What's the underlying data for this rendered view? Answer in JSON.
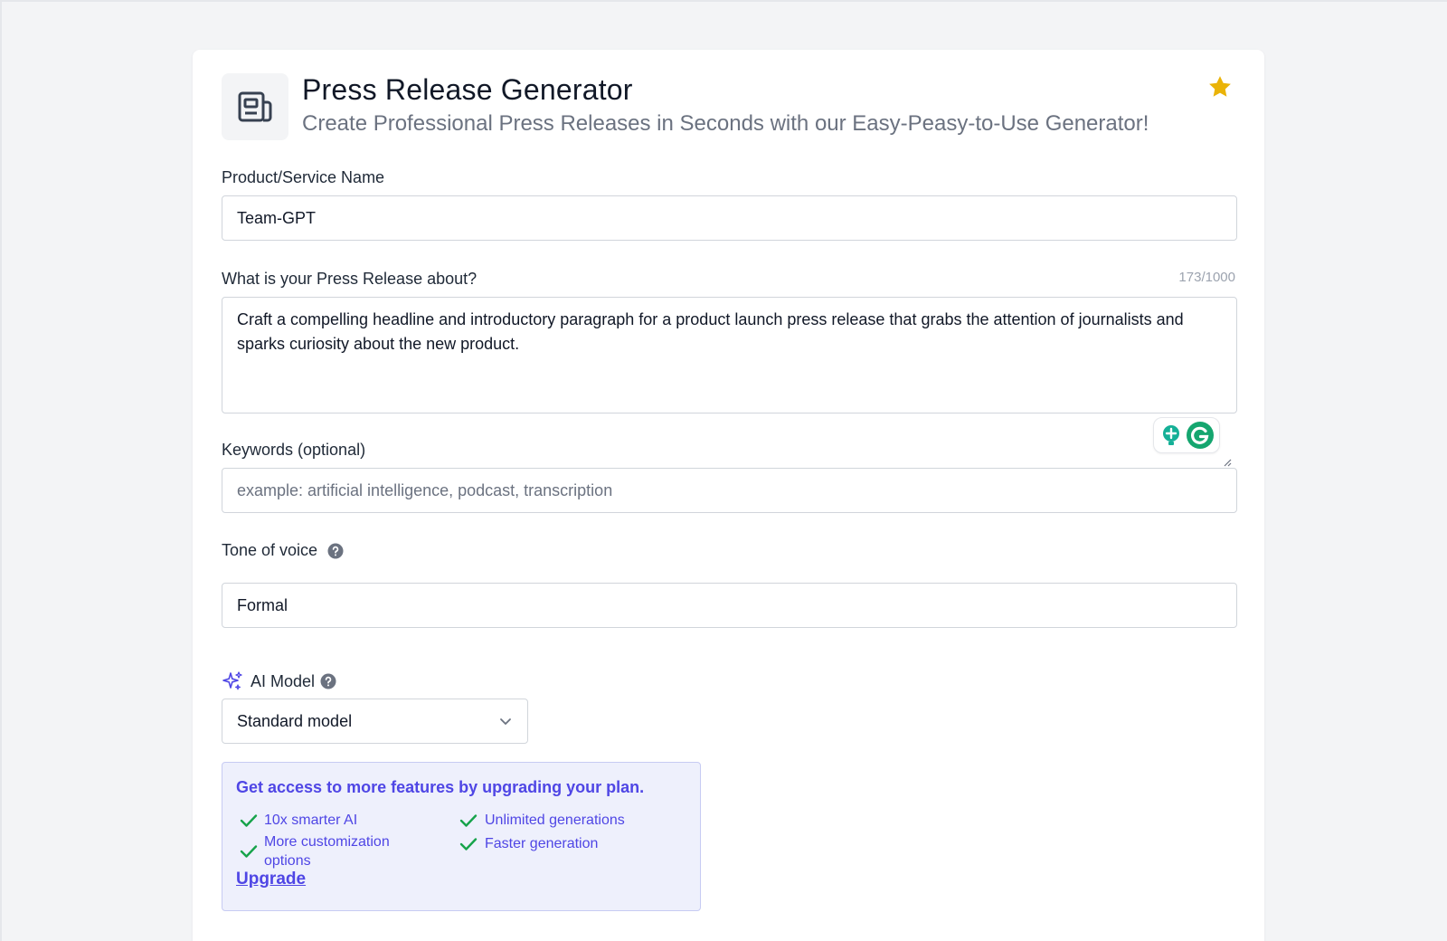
{
  "header": {
    "title": "Press Release Generator",
    "subtitle": "Create Professional Press Releases in Seconds with our Easy-Peasy-to-Use Generator!",
    "icon": "newspaper-icon",
    "favorite_icon": "star-icon",
    "favorite_color": "#eab308"
  },
  "product_name": {
    "label": "Product/Service Name",
    "value": "Team-GPT"
  },
  "about": {
    "label": "What is your Press Release about?",
    "counter": "173/1000",
    "value": "Craft a compelling headline and introductory paragraph for a product launch press release that grabs the attention of journalists and sparks curiosity about the new product."
  },
  "keywords": {
    "label": "Keywords (optional)",
    "placeholder": "example: artificial intelligence, podcast, transcription"
  },
  "tone": {
    "label": "Tone of voice",
    "value": "Formal"
  },
  "ai_model": {
    "label": "AI Model",
    "selected": "Standard model"
  },
  "upgrade": {
    "title": "Get access to more features by upgrading your plan.",
    "features_left": [
      "10x smarter AI",
      "More customization options"
    ],
    "features_right": [
      "Unlimited generations",
      "Faster generation"
    ],
    "link": "Upgrade",
    "accent_color": "#4f46e5",
    "check_color": "#16a34a"
  }
}
